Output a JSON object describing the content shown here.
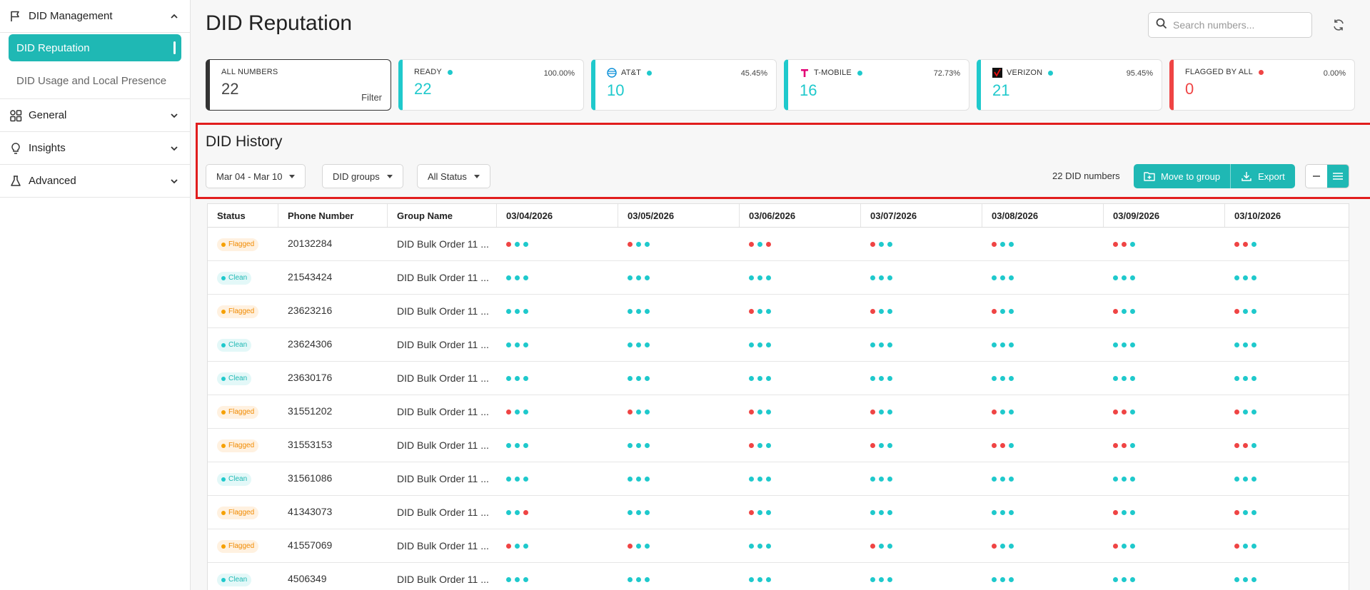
{
  "sidebar": {
    "did_management_label": "DID Management",
    "items": [
      {
        "label": "DID Reputation"
      },
      {
        "label": "DID Usage and Local Presence"
      }
    ],
    "general_label": "General",
    "insights_label": "Insights",
    "advanced_label": "Advanced"
  },
  "header": {
    "title": "DID Reputation",
    "search_placeholder": "Search numbers..."
  },
  "cards": {
    "all": {
      "title": "ALL NUMBERS",
      "value": "22",
      "filter": "Filter"
    },
    "ready": {
      "title": "READY",
      "pct": "100.00%",
      "value": "22"
    },
    "att": {
      "title": "AT&T",
      "pct": "45.45%",
      "value": "10"
    },
    "tmobile": {
      "title": "T-MOBILE",
      "pct": "72.73%",
      "value": "16"
    },
    "verizon": {
      "title": "VERIZON",
      "pct": "95.45%",
      "value": "21"
    },
    "flagged": {
      "title": "FLAGGED BY ALL",
      "pct": "0.00%",
      "value": "0"
    }
  },
  "history": {
    "title": "DID History",
    "date_filter": "Mar 04 - Mar 10",
    "groups_filter": "DID groups",
    "status_filter": "All Status",
    "count": "22 DID numbers",
    "move_label": "Move to group",
    "export_label": "Export"
  },
  "table": {
    "headers": {
      "status": "Status",
      "phone": "Phone Number",
      "group": "Group Name",
      "dates": [
        "03/04/2026",
        "03/05/2026",
        "03/06/2026",
        "03/07/2026",
        "03/08/2026",
        "03/09/2026",
        "03/10/2026"
      ]
    },
    "rows": [
      {
        "status": "Flagged",
        "phone": "20132284",
        "group": "DID Bulk Order 11 ...",
        "dots": [
          "rcc",
          "rcc",
          "rcr",
          "rcc",
          "rcc",
          "rrc",
          "rrc"
        ]
      },
      {
        "status": "Clean",
        "phone": "21543424",
        "group": "DID Bulk Order 11 ...",
        "dots": [
          "ccc",
          "ccc",
          "ccc",
          "ccc",
          "ccc",
          "ccc",
          "ccc"
        ]
      },
      {
        "status": "Flagged",
        "phone": "23623216",
        "group": "DID Bulk Order 11 ...",
        "dots": [
          "ccc",
          "ccc",
          "rcc",
          "rcc",
          "rcc",
          "rcc",
          "rcc"
        ]
      },
      {
        "status": "Clean",
        "phone": "23624306",
        "group": "DID Bulk Order 11 ...",
        "dots": [
          "ccc",
          "ccc",
          "ccc",
          "ccc",
          "ccc",
          "ccc",
          "ccc"
        ]
      },
      {
        "status": "Clean",
        "phone": "23630176",
        "group": "DID Bulk Order 11 ...",
        "dots": [
          "ccc",
          "ccc",
          "ccc",
          "ccc",
          "ccc",
          "ccc",
          "ccc"
        ]
      },
      {
        "status": "Flagged",
        "phone": "31551202",
        "group": "DID Bulk Order 11 ...",
        "dots": [
          "rcc",
          "rcc",
          "rcc",
          "rcc",
          "rcc",
          "rrc",
          "rcc"
        ]
      },
      {
        "status": "Flagged",
        "phone": "31553153",
        "group": "DID Bulk Order 11 ...",
        "dots": [
          "ccc",
          "ccc",
          "rcc",
          "rcc",
          "rrc",
          "rrc",
          "rrc"
        ]
      },
      {
        "status": "Clean",
        "phone": "31561086",
        "group": "DID Bulk Order 11 ...",
        "dots": [
          "ccc",
          "ccc",
          "ccc",
          "ccc",
          "ccc",
          "ccc",
          "ccc"
        ]
      },
      {
        "status": "Flagged",
        "phone": "41343073",
        "group": "DID Bulk Order 11 ...",
        "dots": [
          "ccr",
          "ccc",
          "rcc",
          "ccc",
          "ccc",
          "rcc",
          "rcc"
        ]
      },
      {
        "status": "Flagged",
        "phone": "41557069",
        "group": "DID Bulk Order 11 ...",
        "dots": [
          "rcc",
          "rcc",
          "ccc",
          "rcc",
          "rcc",
          "rcc",
          "rcc"
        ]
      },
      {
        "status": "Clean",
        "phone": "4506349",
        "group": "DID Bulk Order 11 ...",
        "dots": [
          "ccc",
          "ccc",
          "ccc",
          "ccc",
          "ccc",
          "ccc",
          "ccc"
        ]
      }
    ]
  },
  "colors": {
    "accent": "#1fb8b4",
    "clean_dot": "#1fc9cc",
    "flag_dot": "#ef4444",
    "flagged_badge": "#f08a00",
    "highlight": "#e11d1d"
  }
}
